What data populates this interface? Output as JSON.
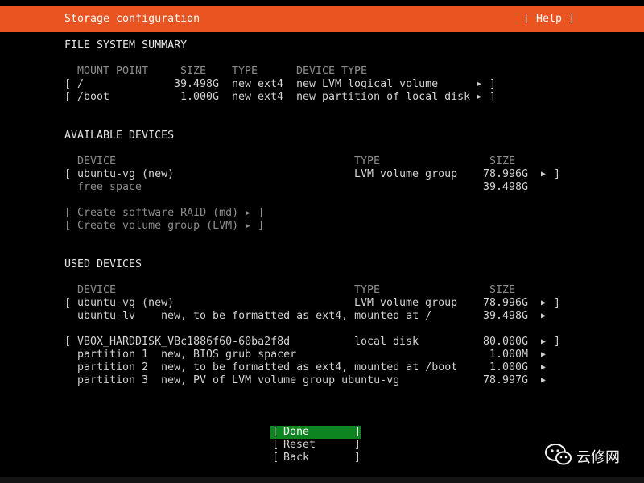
{
  "header": {
    "title": "Storage configuration",
    "help": "[ Help ]",
    "accent_color": "#e95420"
  },
  "summary": {
    "heading": "FILE SYSTEM SUMMARY",
    "columns": [
      "MOUNT POINT",
      "SIZE",
      "TYPE",
      "DEVICE TYPE"
    ],
    "rows": [
      {
        "mount": "/",
        "size": "39.498G",
        "type": "new ext4",
        "device_type": "new LVM logical volume"
      },
      {
        "mount": "/boot",
        "size": "1.000G",
        "type": "new ext4",
        "device_type": "new partition of local disk"
      }
    ]
  },
  "available": {
    "heading": "AVAILABLE DEVICES",
    "columns": [
      "DEVICE",
      "TYPE",
      "SIZE"
    ],
    "rows": [
      {
        "device": "ubuntu-vg (new)",
        "type": "LVM volume group",
        "size": "78.996G"
      },
      {
        "device": "free space",
        "type": "",
        "size": "39.498G"
      }
    ],
    "actions": [
      "[ Create software RAID (md) ▸ ]",
      "[ Create volume group (LVM) ▸ ]"
    ]
  },
  "used": {
    "heading": "USED DEVICES",
    "columns": [
      "DEVICE",
      "TYPE",
      "SIZE"
    ],
    "group1": [
      {
        "device": "ubuntu-vg (new)",
        "desc": "",
        "type": "LVM volume group",
        "size": "78.996G"
      },
      {
        "device": "ubuntu-lv",
        "desc": "new, to be formatted as ext4, mounted at /",
        "type": "",
        "size": "39.498G"
      }
    ],
    "group2": [
      {
        "device": "VBOX_HARDDISK_VBc1886f60-60ba2f8d",
        "desc": "",
        "type": "local disk",
        "size": "80.000G"
      },
      {
        "device": "partition 1",
        "desc": "new, BIOS grub spacer",
        "type": "",
        "size": "1.000M"
      },
      {
        "device": "partition 2",
        "desc": "new, to be formatted as ext4, mounted at /boot",
        "type": "",
        "size": "1.000G"
      },
      {
        "device": "partition 3",
        "desc": "new, PV of LVM volume group ubuntu-vg",
        "type": "",
        "size": "78.997G"
      }
    ]
  },
  "buttons": {
    "done": "Done",
    "reset": "Reset",
    "back": "Back",
    "selected_color": "#0e8420"
  },
  "watermark": {
    "text": "云修网",
    "icon": "wechat-icon"
  }
}
